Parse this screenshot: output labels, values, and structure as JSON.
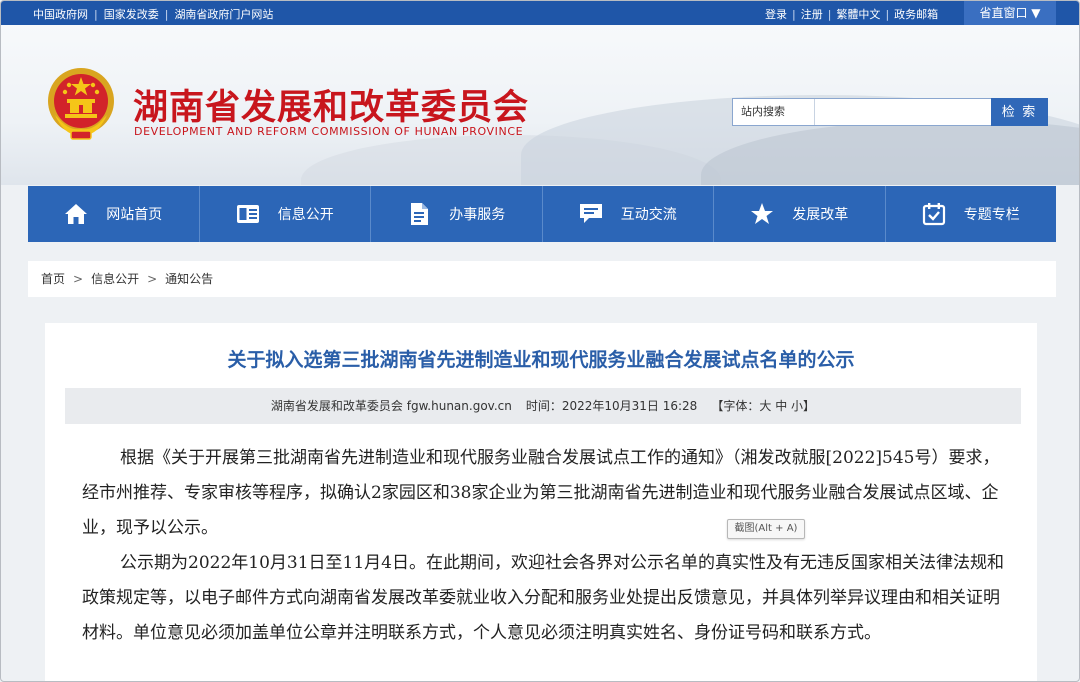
{
  "topbar": {
    "links": [
      "中国政府网",
      "国家发改委",
      "湖南省政府门户网站"
    ],
    "right_links": [
      "登录",
      "注册",
      "繁體中文",
      "政务邮箱"
    ],
    "province_button": "省直窗口 ▼"
  },
  "header": {
    "title_cn": "湖南省发展和改革委员会",
    "title_en": "DEVELOPMENT AND REFORM COMMISSION OF HUNAN PROVINCE"
  },
  "search": {
    "label": "站内搜索",
    "placeholder": "",
    "button": "检 索"
  },
  "nav": {
    "items": [
      {
        "label": "网站首页",
        "icon": "home-icon"
      },
      {
        "label": "信息公开",
        "icon": "info-card-icon"
      },
      {
        "label": "办事服务",
        "icon": "document-icon"
      },
      {
        "label": "互动交流",
        "icon": "chat-icon"
      },
      {
        "label": "发展改革",
        "icon": "star-icon"
      },
      {
        "label": "专题专栏",
        "icon": "calendar-check-icon"
      }
    ]
  },
  "breadcrumb": [
    "首页",
    "信息公开",
    "通知公告"
  ],
  "article": {
    "title": "关于拟入选第三批湖南省先进制造业和现代服务业融合发展试点名单的公示",
    "meta_source": "湖南省发展和改革委员会 fgw.hunan.gov.cn",
    "meta_time": "时间：2022年10月31日 16:28",
    "meta_font_prefix": "【字体：",
    "meta_font_large": "大",
    "meta_font_medium": "中",
    "meta_font_small": "小",
    "meta_font_suffix": "】",
    "paragraph1": "根据《关于开展第三批湖南省先进制造业和现代服务业融合发展试点工作的通知》（湘发改就服[2022]545号）要求，经市州推荐、专家审核等程序，拟确认2家园区和38家企业为第三批湖南省先进制造业和现代服务业融合发展试点区域、企业，现予以公示。",
    "paragraph2": "公示期为2022年10月31日至11月4日。在此期间，欢迎社会各界对公示名单的真实性及有无违反国家相关法律法规和政策规定等，以电子邮件方式向湖南省发展改革委就业收入分配和服务业处提出反馈意见，并具体列举异议理由和相关证明材料。单位意见必须加盖单位公章并注明联系方式，个人意见必须注明真实姓名、身份证号码和联系方式。"
  },
  "tooltip": "截图(Alt + A)",
  "colors": {
    "brand_red": "#c8161d",
    "nav_blue": "#2c66b7",
    "title_blue": "#2a5ea8"
  }
}
